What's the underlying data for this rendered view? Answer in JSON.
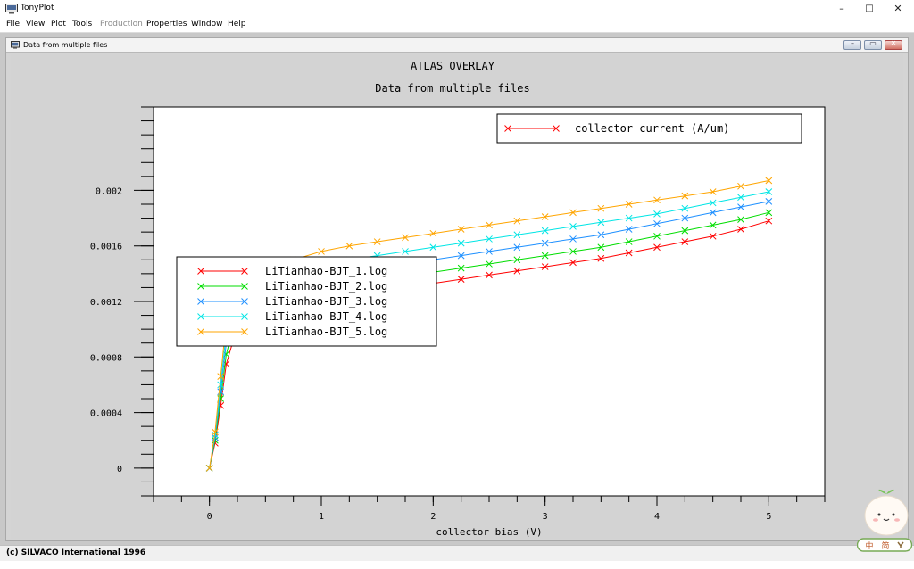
{
  "window": {
    "title": "TonyPlot",
    "controls": {
      "minimize": "–",
      "maximize": "□",
      "close": "✕"
    }
  },
  "menu": {
    "items": [
      {
        "label": "File",
        "enabled": true
      },
      {
        "label": "View",
        "enabled": true
      },
      {
        "label": "Plot",
        "enabled": true
      },
      {
        "label": "Tools",
        "enabled": true
      },
      {
        "label": "Production",
        "enabled": false
      },
      {
        "label": "Properties",
        "enabled": true
      },
      {
        "label": "Window",
        "enabled": true
      },
      {
        "label": "Help",
        "enabled": true
      }
    ]
  },
  "child_window": {
    "title": "Data from multiple files"
  },
  "status": {
    "text": "(c) SILVACO International 1996"
  },
  "ime": {
    "labels": [
      "中",
      "简"
    ]
  },
  "chart_data": {
    "type": "line",
    "title": "ATLAS OVERLAY",
    "subtitle": "Data from multiple files",
    "xlabel": "collector bias (V)",
    "ylabel": "",
    "xlim": [
      -0.5,
      5.5
    ],
    "ylim": [
      -0.0002,
      0.0026
    ],
    "x_ticks": [
      0,
      1,
      2,
      3,
      4,
      5
    ],
    "x_tick_labels": [
      "0",
      "1",
      "2",
      "3",
      "4",
      "5"
    ],
    "y_ticks": [
      0,
      0.0004,
      0.0008,
      0.0012,
      0.0016,
      0.002
    ],
    "y_tick_labels": [
      "0",
      "0.0004",
      "0.0008",
      "0.0012",
      "0.0016",
      "0.002"
    ],
    "grid": false,
    "quantity_legend": {
      "placement": "top-right",
      "label": "collector current (A/um)",
      "color": "#ff0000"
    },
    "legend": {
      "placement": "center-left"
    },
    "series": [
      {
        "name": "LiTianhao-BJT_1.log",
        "color": "#ff0000",
        "x": [
          0,
          0.05,
          0.1,
          0.15,
          0.25,
          0.5,
          0.75,
          1,
          1.25,
          1.5,
          1.75,
          2,
          2.25,
          2.5,
          2.75,
          3,
          3.25,
          3.5,
          3.75,
          4,
          4.25,
          4.5,
          4.75,
          5
        ],
        "y": [
          0,
          0.00018,
          0.00045,
          0.00075,
          0.00102,
          0.00118,
          0.00122,
          0.00123,
          0.00125,
          0.00127,
          0.0013,
          0.00133,
          0.00136,
          0.00139,
          0.00142,
          0.00145,
          0.00148,
          0.00151,
          0.00155,
          0.00159,
          0.00163,
          0.00167,
          0.00172,
          0.00178
        ]
      },
      {
        "name": "LiTianhao-BJT_2.log",
        "color": "#00dd00",
        "x": [
          0,
          0.05,
          0.1,
          0.15,
          0.25,
          0.5,
          0.75,
          1,
          1.25,
          1.5,
          1.75,
          2,
          2.25,
          2.5,
          2.75,
          3,
          3.25,
          3.5,
          3.75,
          4,
          4.25,
          4.5,
          4.75,
          5
        ],
        "y": [
          0,
          0.0002,
          0.0005,
          0.00082,
          0.00112,
          0.00123,
          0.00127,
          0.0013,
          0.00133,
          0.00135,
          0.00138,
          0.00141,
          0.00144,
          0.00147,
          0.0015,
          0.00153,
          0.00156,
          0.00159,
          0.00163,
          0.00167,
          0.00171,
          0.00175,
          0.00179,
          0.00184
        ]
      },
      {
        "name": "LiTianhao-BJT_3.log",
        "color": "#1e90ff",
        "x": [
          0,
          0.05,
          0.1,
          0.15,
          0.25,
          0.5,
          0.75,
          1,
          1.25,
          1.5,
          1.75,
          2,
          2.25,
          2.5,
          2.75,
          3,
          3.25,
          3.5,
          3.75,
          4,
          4.25,
          4.5,
          4.75,
          5
        ],
        "y": [
          0,
          0.00022,
          0.00055,
          0.0009,
          0.00122,
          0.00131,
          0.00135,
          0.00138,
          0.00141,
          0.00144,
          0.00147,
          0.0015,
          0.00153,
          0.00156,
          0.00159,
          0.00162,
          0.00165,
          0.00168,
          0.00172,
          0.00176,
          0.0018,
          0.00184,
          0.00188,
          0.00192
        ]
      },
      {
        "name": "LiTianhao-BJT_4.log",
        "color": "#00e5e5",
        "x": [
          0,
          0.05,
          0.1,
          0.15,
          0.25,
          0.5,
          0.75,
          1,
          1.25,
          1.5,
          1.75,
          2,
          2.25,
          2.5,
          2.75,
          3,
          3.25,
          3.5,
          3.75,
          4,
          4.25,
          4.5,
          4.75,
          5
        ],
        "y": [
          0,
          0.00024,
          0.0006,
          0.00098,
          0.00131,
          0.00139,
          0.00143,
          0.00147,
          0.0015,
          0.00153,
          0.00156,
          0.00159,
          0.00162,
          0.00165,
          0.00168,
          0.00171,
          0.00174,
          0.00177,
          0.0018,
          0.00183,
          0.00187,
          0.00191,
          0.00195,
          0.00199
        ]
      },
      {
        "name": "LiTianhao-BJT_5.log",
        "color": "#ffa500",
        "x": [
          0,
          0.05,
          0.1,
          0.15,
          0.25,
          0.5,
          0.75,
          1,
          1.25,
          1.5,
          1.75,
          2,
          2.25,
          2.5,
          2.75,
          3,
          3.25,
          3.5,
          3.75,
          4,
          4.25,
          4.5,
          4.75,
          5
        ],
        "y": [
          0,
          0.00026,
          0.00066,
          0.00106,
          0.0014,
          0.00142,
          0.0015,
          0.00156,
          0.0016,
          0.00163,
          0.00166,
          0.00169,
          0.00172,
          0.00175,
          0.00178,
          0.00181,
          0.00184,
          0.00187,
          0.0019,
          0.00193,
          0.00196,
          0.00199,
          0.00203,
          0.00207
        ]
      }
    ]
  }
}
